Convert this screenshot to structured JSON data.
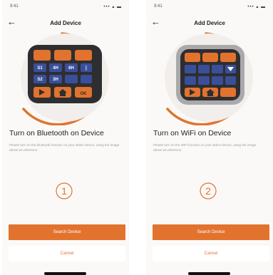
{
  "colors": {
    "accent": "#e2732e",
    "background": "#fbf9f8"
  },
  "screens": [
    {
      "status": {
        "time": "9:41",
        "icons": "••• ▴ ▬"
      },
      "nav": {
        "back_icon": "back-arrow-icon",
        "title": "Add Device"
      },
      "device_image": {
        "icon": "bluetooth-icon",
        "keypad_labels": [
          "S1",
          "4H",
          "6H",
          "S2",
          "3H",
          "OK"
        ]
      },
      "instruction": {
        "title": "Turn on Bluetooth on Device",
        "description": "Please turn on the bluetooth function on your select device, using the image above as reference."
      },
      "step_number": "①",
      "search_button": "Search Device",
      "cancel_button": "Cancel"
    },
    {
      "status": {
        "time": "9:41",
        "icons": "••• ▴ ▬"
      },
      "nav": {
        "back_icon": "back-arrow-icon",
        "title": "Add Device"
      },
      "device_image": {
        "icon": "wifi-icon"
      },
      "instruction": {
        "title": "Turn on WiFi on Device",
        "description": "Please turn on the WiFi function on your select device, using the image above as reference."
      },
      "step_number": "②",
      "search_button": "Search Device",
      "cancel_button": "Cancel"
    }
  ]
}
